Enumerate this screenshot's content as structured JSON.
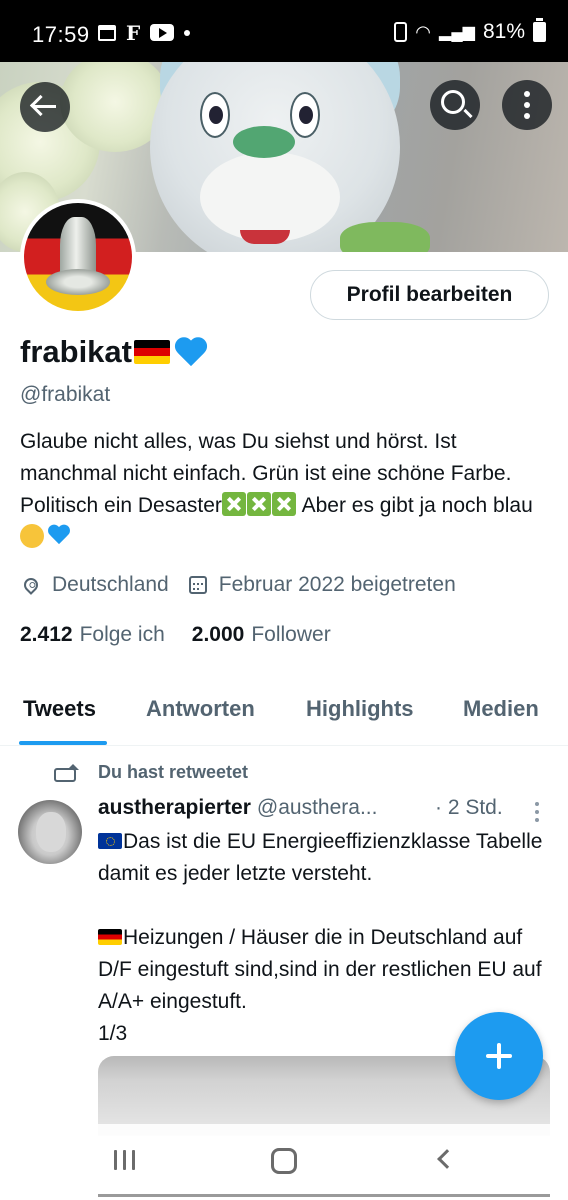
{
  "status_bar": {
    "time": "17:59",
    "battery": "81%",
    "icons": [
      "calendar-icon",
      "flipboard-icon",
      "youtube-icon",
      "notification-dot",
      "battery-saver-icon",
      "wifi-icon",
      "signal-icon",
      "battery-icon"
    ]
  },
  "header": {
    "icons": [
      "back-arrow-icon",
      "search-icon",
      "more-vertical-icon"
    ]
  },
  "profile": {
    "edit_button": "Profil bearbeiten",
    "display_name": "frabikat",
    "name_emoji": [
      "flag-germany",
      "blue-heart"
    ],
    "handle": "@frabikat",
    "bio": {
      "line1": "Glaube nicht alles, was Du siehst und hörst. Ist manchmal nicht einfach. Grün ist eine schöne Farbe. Politisch ein Desaster",
      "line2": " Aber es gibt ja noch blau"
    },
    "location": "Deutschland",
    "joined": "Februar 2022 beigetreten",
    "following_count": "2.412",
    "following_label": "Folge ich",
    "followers_count": "2.000",
    "followers_label": "Follower"
  },
  "tabs": [
    {
      "label": "Tweets",
      "active": true
    },
    {
      "label": "Antworten",
      "active": false
    },
    {
      "label": "Highlights",
      "active": false
    },
    {
      "label": "Medien",
      "active": false
    }
  ],
  "tweet": {
    "retweet_label": "Du hast retweetet",
    "author_name": "austherapierter",
    "author_handle": "@austhera...",
    "time": "· 2 Std.",
    "text_part1": "Das ist die EU Energieeffizienzklasse Tabelle damit es jeder letzte versteht.",
    "text_part2": "Heizungen / Häuser die in Deutschland auf D/F eingestuft sind,sind in der restlichen EU auf A/A+ eingestuft.\n1/3"
  },
  "colors": {
    "accent": "#1d9bf0",
    "text_primary": "#0f1419",
    "text_secondary": "#536471"
  }
}
